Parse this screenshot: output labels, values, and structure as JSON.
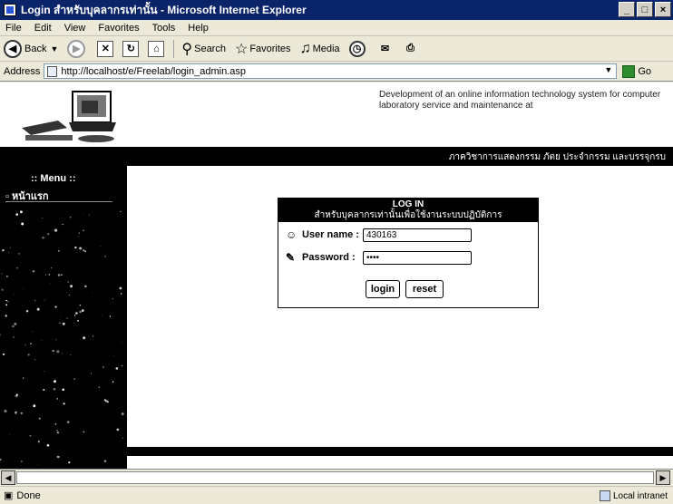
{
  "window": {
    "title": "Login สำหรับบุคลากรเท่านั้น - Microsoft Internet Explorer",
    "controls": [
      "_",
      "□",
      "×"
    ]
  },
  "menubar": [
    "File",
    "Edit",
    "View",
    "Favorites",
    "Tools",
    "Help"
  ],
  "toolbar": {
    "back": "Back",
    "search": "Search",
    "favorites": "Favorites",
    "media": "Media"
  },
  "address": {
    "label": "Address",
    "url": "http://localhost/e/Freelab/login_admin.asp",
    "go": "Go"
  },
  "banner": {
    "text": "Development of an online information technology system for computer laboratory service and maintenance at",
    "strip_text": "ภาควิชาการแสดงกรรม ภัตย ประจำกรรม และบรรจุกรบ"
  },
  "sidebar": {
    "title": ":: Menu ::",
    "item": "หน้าแรก"
  },
  "login": {
    "heading": "LOG IN",
    "subheading": "สำหรับบุคลากรเท่านั้นเพื่อใช้งานระบบปฏิบัติการ",
    "username_label": "User name :",
    "username_value": "430163",
    "password_label": "Password :",
    "password_value": "••••",
    "login_button": "login",
    "reset_button": "reset"
  },
  "status": {
    "left": "Done",
    "zone": "Local intranet"
  }
}
